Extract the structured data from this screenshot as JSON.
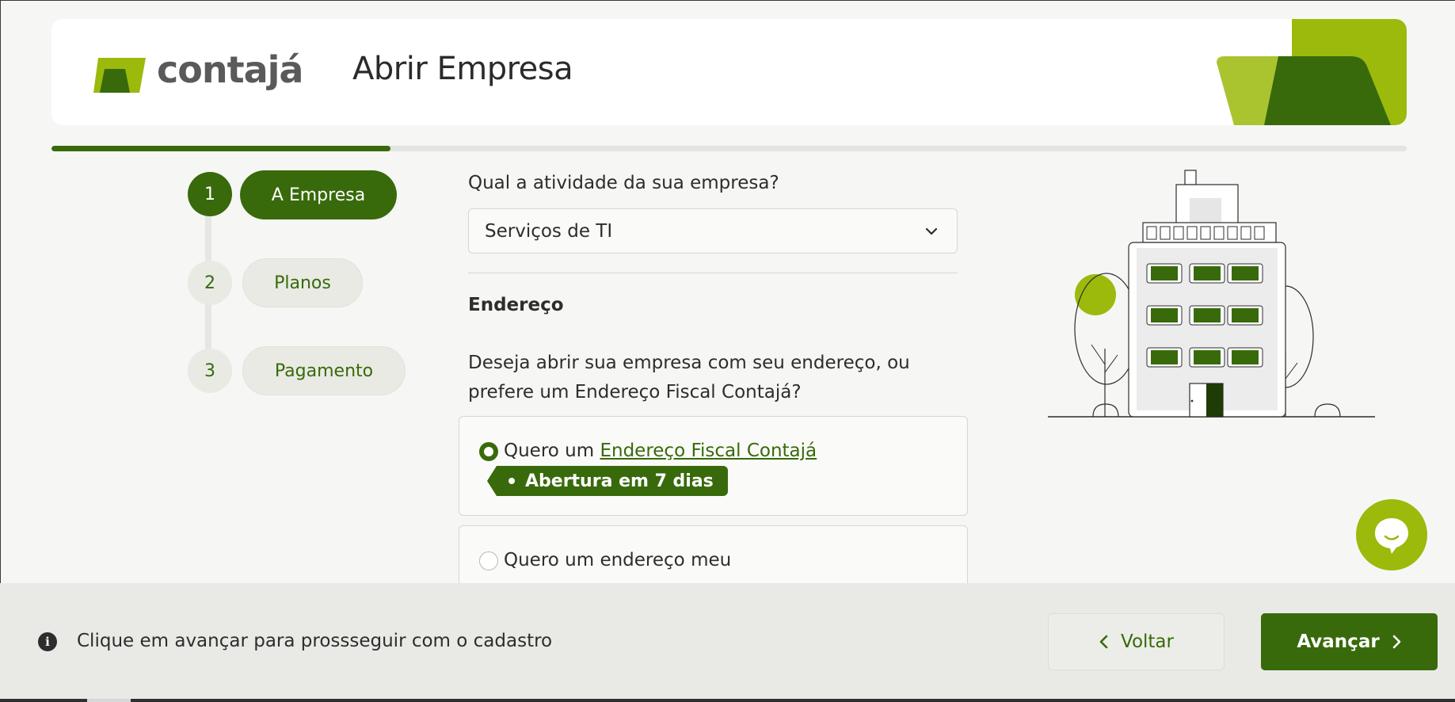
{
  "app": {
    "logo_text": "contajá",
    "page_title": "Abrir Empresa",
    "progress_fraction": 0.25
  },
  "steps": [
    {
      "number": "1",
      "label": "A Empresa",
      "active": true
    },
    {
      "number": "2",
      "label": "Planos",
      "active": false
    },
    {
      "number": "3",
      "label": "Pagamento",
      "active": false
    }
  ],
  "form": {
    "activity_question": "Qual a atividade da sua empresa?",
    "activity_value": "Serviços de TI",
    "address_section_title": "Endereço",
    "address_question": "Deseja abrir sua empresa com seu endereço, ou prefere um Endereço Fiscal Contajá?",
    "option_fiscal": {
      "prefix": "Quero um ",
      "link": "Endereço Fiscal Contajá",
      "tag": "Abertura em 7 dias",
      "selected": true
    },
    "option_own": {
      "label": "Quero um endereço meu",
      "selected": false
    }
  },
  "footer": {
    "info_message": "Clique em avançar para prossseguir com o cadastro",
    "back_label": "Voltar",
    "next_label": "Avançar"
  },
  "colors": {
    "primary": "#386a0b",
    "accent": "#9bba0c",
    "background": "#f6f6f4"
  },
  "icons": [
    "logo-mark-icon",
    "chevron-down-icon",
    "info-icon",
    "chevron-left-icon",
    "chevron-right-icon",
    "chat-bubble-icon",
    "building-illustration"
  ]
}
